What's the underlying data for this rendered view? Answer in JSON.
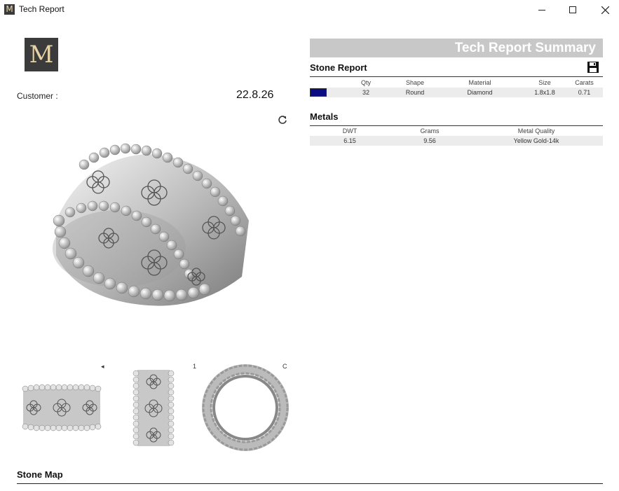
{
  "window": {
    "title": "Tech Report",
    "app_icon_letter": "M"
  },
  "logo": {
    "letter": "M"
  },
  "customer": {
    "label": "Customer :",
    "date": "22.8.26"
  },
  "summary": {
    "title": "Tech Report Summary"
  },
  "stone_report": {
    "title": "Stone Report",
    "columns": [
      "",
      "Qty",
      "Shape",
      "Material",
      "Size",
      "Carats"
    ],
    "rows": [
      {
        "color": "#0b0b83",
        "qty": "32",
        "shape": "Round",
        "material": "Diamond",
        "size": "1.8x1.8",
        "carats": "0.71"
      }
    ]
  },
  "metals": {
    "title": "Metals",
    "columns": [
      "DWT",
      "Grams",
      "Metal Quality"
    ],
    "rows": [
      {
        "dwt": "6.15",
        "grams": "9.56",
        "quality": "Yellow Gold-14k"
      }
    ]
  },
  "stone_map": {
    "title": "Stone Map"
  },
  "view_ticks": [
    "1",
    "C"
  ]
}
